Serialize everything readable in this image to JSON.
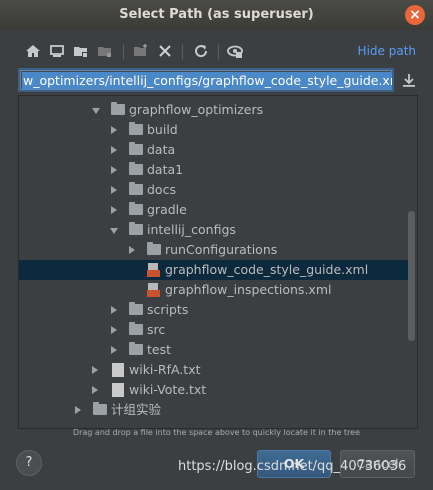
{
  "window": {
    "title": "Select Path (as superuser)",
    "close_icon": "close-icon"
  },
  "toolbar": {
    "icons": [
      "home-icon",
      "desktop-icon",
      "project-folder-icon",
      "module-folder-icon",
      "new-folder-icon",
      "delete-icon",
      "refresh-icon",
      "show-hidden-icon"
    ],
    "hide_path_label": "Hide path"
  },
  "path_field": {
    "value": "w_optimizers/intellij_configs/graphflow_code_style_guide.xml"
  },
  "tree": {
    "rows": [
      {
        "label": "graphflow_optimizers"
      },
      {
        "label": "build"
      },
      {
        "label": "data"
      },
      {
        "label": "data1"
      },
      {
        "label": "docs"
      },
      {
        "label": "gradle"
      },
      {
        "label": "intellij_configs"
      },
      {
        "label": "runConfigurations"
      },
      {
        "label": "graphflow_code_style_guide.xml"
      },
      {
        "label": "graphflow_inspections.xml"
      },
      {
        "label": "scripts"
      },
      {
        "label": "src"
      },
      {
        "label": "test"
      },
      {
        "label": "wiki-RfA.txt"
      },
      {
        "label": "wiki-Vote.txt"
      },
      {
        "label": "计组实验"
      }
    ]
  },
  "hint": "Drag and drop a file into the space above to quickly locate it in the tree",
  "buttons": {
    "help": "?",
    "ok": "OK",
    "cancel": "Cancel"
  },
  "watermark": "https://blog.csdn.net/qq_40736036",
  "colors": {
    "accent": "#589df6",
    "selection": "#0d293e",
    "background": "#3c3f41"
  }
}
